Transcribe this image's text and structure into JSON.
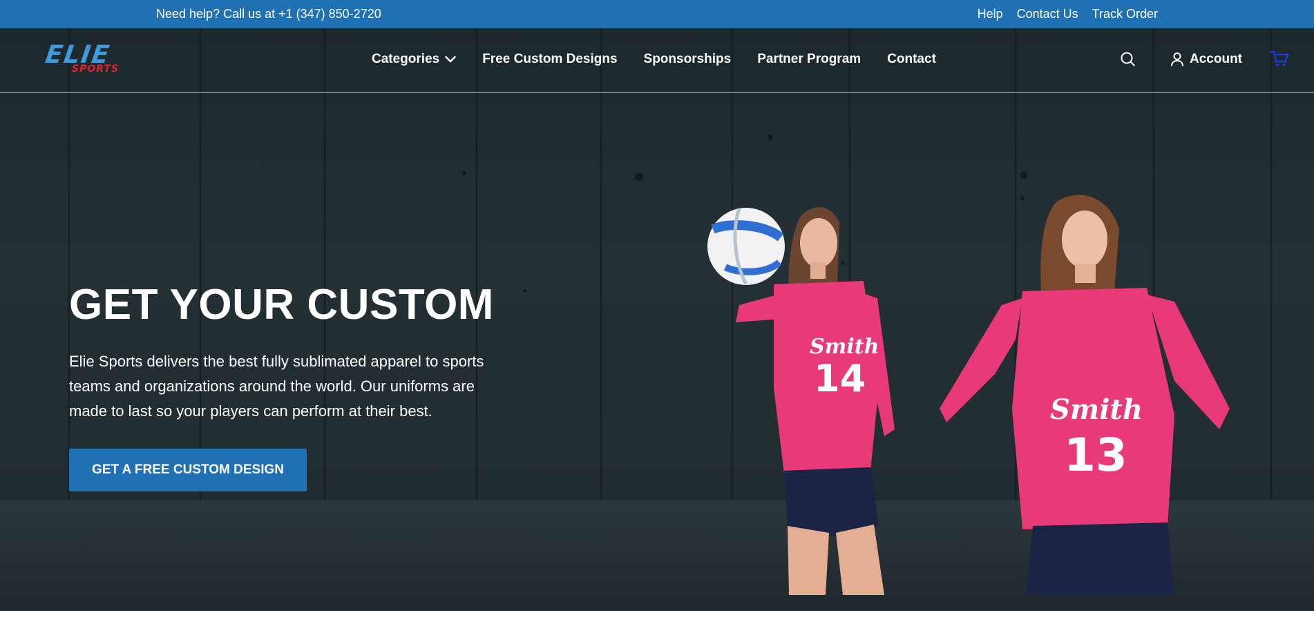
{
  "topbar": {
    "help_text": "Need help? Call us at +1 (347) 850-2720",
    "links": [
      "Help",
      "Contact Us",
      "Track Order"
    ]
  },
  "header": {
    "logo_main": "ELIE",
    "logo_sub": "SPORTS",
    "nav": [
      "Categories",
      "Free Custom Designs",
      "Sponsorships",
      "Partner Program",
      "Contact"
    ],
    "account_label": "Account"
  },
  "hero": {
    "title": "GET YOUR CUSTOM",
    "description": "Elie Sports delivers the best fully sublimated apparel to sports teams and organizations around the world. Our uniforms are made to last so your players can perform at their best.",
    "cta_label": "GET A FREE CUSTOM DESIGN",
    "player_left": {
      "name": "Smith",
      "number": "14"
    },
    "player_right": {
      "name": "Smith",
      "number": "13"
    }
  },
  "colors": {
    "brand_blue": "#2070b4",
    "hero_dark": "#222d31",
    "jersey_pink": "#e83a78",
    "logo_red": "#e0242f"
  },
  "icons": [
    "chevron-down-icon",
    "search-icon",
    "user-icon",
    "cart-icon"
  ]
}
